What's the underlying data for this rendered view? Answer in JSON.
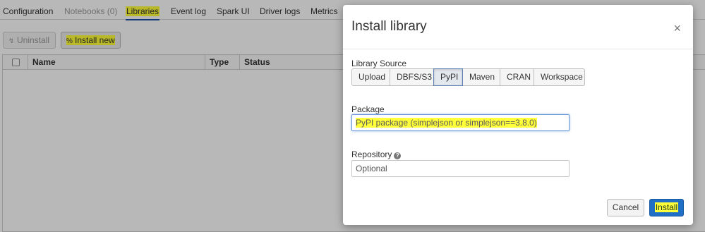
{
  "tabs": [
    {
      "label": "Configuration",
      "state": "normal"
    },
    {
      "label": "Notebooks (0)",
      "state": "disabled"
    },
    {
      "label": "Libraries",
      "state": "active"
    },
    {
      "label": "Event log",
      "state": "normal"
    },
    {
      "label": "Spark UI",
      "state": "normal"
    },
    {
      "label": "Driver logs",
      "state": "normal"
    },
    {
      "label": "Metrics",
      "state": "normal"
    }
  ],
  "toolbar": {
    "uninstall_label": "Uninstall",
    "install_new_label": "Install new"
  },
  "table": {
    "columns": [
      "Name",
      "Type",
      "Status"
    ]
  },
  "modal": {
    "title": "Install library",
    "close_glyph": "×",
    "library_source_label": "Library Source",
    "sources": [
      "Upload",
      "DBFS/S3",
      "PyPI",
      "Maven",
      "CRAN",
      "Workspace"
    ],
    "selected_source": "PyPI",
    "package_label": "Package",
    "package_placeholder": "PyPI package (simplejson or simplejson==3.8.0)",
    "package_value": "",
    "repository_label": "Repository",
    "repository_help_glyph": "?",
    "repository_placeholder": "Optional",
    "cancel_label": "Cancel",
    "install_label": "Install"
  },
  "colors": {
    "accent": "#1f6fc5",
    "highlight": "#ffff3a",
    "overlay": "rgba(0,0,0,0.28)"
  }
}
